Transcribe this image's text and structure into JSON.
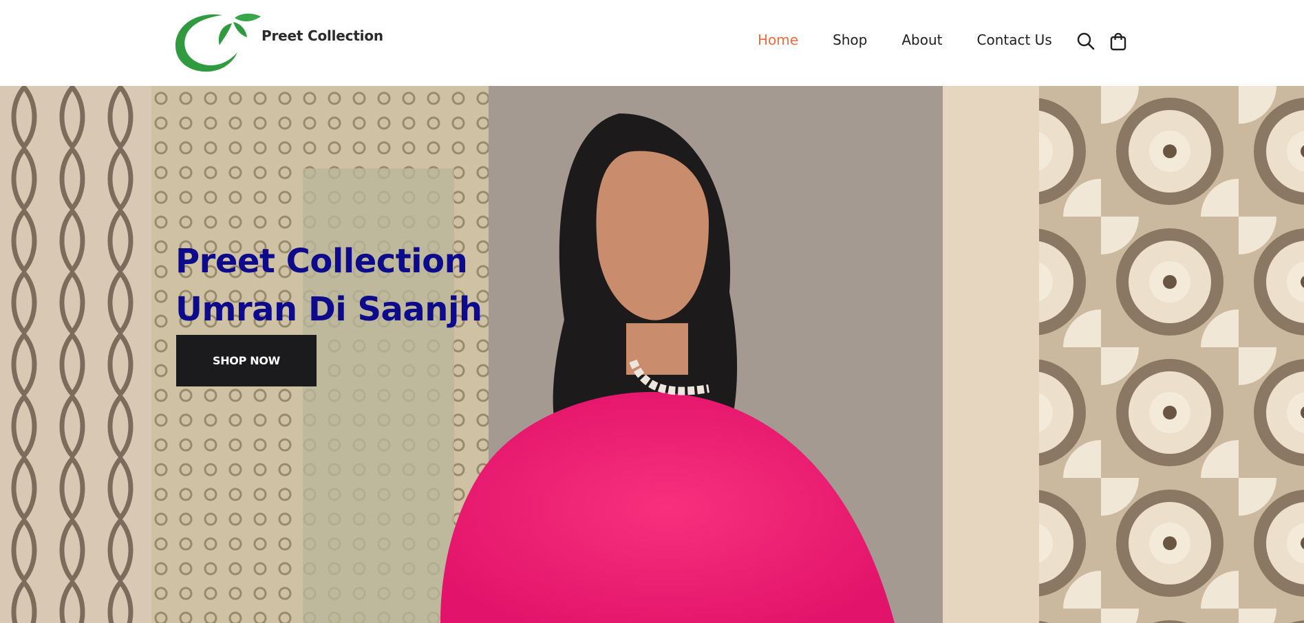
{
  "header": {
    "brand_name": "Preet Collection",
    "nav": [
      {
        "label": "Home",
        "active": true
      },
      {
        "label": "Shop",
        "active": false
      },
      {
        "label": "About",
        "active": false
      },
      {
        "label": "Contact Us",
        "active": false
      }
    ],
    "icons": [
      "search-icon",
      "shopping-bag-icon"
    ]
  },
  "hero": {
    "title_line1": "Preet Collection",
    "title_line2": "Umran Di Saanjh",
    "cta_label": "SHOP NOW"
  },
  "colors": {
    "accent_active_nav": "#f26b3a",
    "hero_title": "#0d0a8c",
    "button_bg": "#1b1b1d",
    "logo_green": "#2f9a3e"
  }
}
